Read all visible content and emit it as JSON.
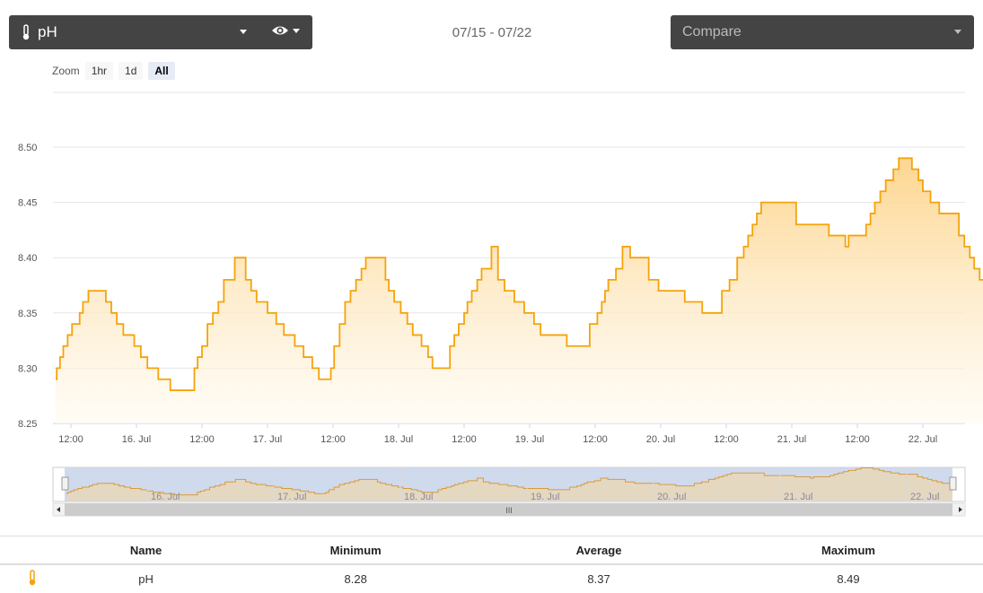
{
  "header": {
    "sensor_label": "pH",
    "sensor_icon": "thermometer-icon",
    "visibility_icon": "eye-icon",
    "date_range": "07/15 - 07/22",
    "compare_placeholder": "Compare"
  },
  "zoom": {
    "label": "Zoom",
    "options": [
      "1hr",
      "1d",
      "All"
    ],
    "selected": "All"
  },
  "colors": {
    "series": "#f5a30b",
    "fill_top": "#fdd48b",
    "fill_bottom": "#fffaf0",
    "navigator_band": "#c7d3ea"
  },
  "chart_data": {
    "type": "area",
    "ylim": [
      8.25,
      8.5
    ],
    "y_ticks": [
      "8.25",
      "8.30",
      "8.35",
      "8.40",
      "8.45",
      "8.50"
    ],
    "x_ticks": [
      "12:00",
      "16. Jul",
      "12:00",
      "17. Jul",
      "12:00",
      "18. Jul",
      "12:00",
      "19. Jul",
      "12:00",
      "20. Jul",
      "12:00",
      "21. Jul",
      "12:00",
      "22. Jul"
    ],
    "x_unit": "hours since the 12:00 tick left of 16. Jul",
    "points": [
      [
        -2.8,
        8.29
      ],
      [
        -2.6,
        8.3
      ],
      [
        -2,
        8.31
      ],
      [
        -1.4,
        8.32
      ],
      [
        -0.6,
        8.33
      ],
      [
        0.2,
        8.34
      ],
      [
        1.6,
        8.35
      ],
      [
        2.2,
        8.36
      ],
      [
        3.2,
        8.37
      ],
      [
        5.8,
        8.37
      ],
      [
        6.4,
        8.36
      ],
      [
        7.4,
        8.35
      ],
      [
        8.4,
        8.34
      ],
      [
        9.6,
        8.33
      ],
      [
        11.6,
        8.32
      ],
      [
        12.8,
        8.31
      ],
      [
        14,
        8.3
      ],
      [
        16,
        8.29
      ],
      [
        18.2,
        8.28
      ],
      [
        22.6,
        8.3
      ],
      [
        23.2,
        8.31
      ],
      [
        24,
        8.32
      ],
      [
        25,
        8.34
      ],
      [
        26,
        8.35
      ],
      [
        27,
        8.36
      ],
      [
        28,
        8.38
      ],
      [
        30,
        8.4
      ],
      [
        32,
        8.38
      ],
      [
        33,
        8.37
      ],
      [
        34,
        8.36
      ],
      [
        36,
        8.35
      ],
      [
        37.6,
        8.34
      ],
      [
        39,
        8.33
      ],
      [
        41,
        8.32
      ],
      [
        42.6,
        8.31
      ],
      [
        44.2,
        8.3
      ],
      [
        45.4,
        8.29
      ],
      [
        47.6,
        8.3
      ],
      [
        48.2,
        8.32
      ],
      [
        49.2,
        8.34
      ],
      [
        50.2,
        8.36
      ],
      [
        51.2,
        8.37
      ],
      [
        52.2,
        8.38
      ],
      [
        53.2,
        8.39
      ],
      [
        54,
        8.4
      ],
      [
        57.6,
        8.38
      ],
      [
        58.2,
        8.37
      ],
      [
        59.2,
        8.36
      ],
      [
        60.4,
        8.35
      ],
      [
        61.6,
        8.34
      ],
      [
        62.6,
        8.33
      ],
      [
        64.2,
        8.32
      ],
      [
        65.4,
        8.31
      ],
      [
        66.2,
        8.3
      ],
      [
        69.4,
        8.32
      ],
      [
        70.2,
        8.33
      ],
      [
        71,
        8.34
      ],
      [
        72,
        8.35
      ],
      [
        72.6,
        8.36
      ],
      [
        73.4,
        8.37
      ],
      [
        74.4,
        8.38
      ],
      [
        75.2,
        8.39
      ],
      [
        77,
        8.41
      ],
      [
        78.2,
        8.38
      ],
      [
        79.4,
        8.37
      ],
      [
        81.2,
        8.36
      ],
      [
        83,
        8.35
      ],
      [
        84.8,
        8.34
      ],
      [
        86,
        8.33
      ],
      [
        90.8,
        8.32
      ],
      [
        95,
        8.34
      ],
      [
        96.4,
        8.35
      ],
      [
        97.2,
        8.36
      ],
      [
        97.8,
        8.37
      ],
      [
        98.4,
        8.38
      ],
      [
        99.8,
        8.39
      ],
      [
        101,
        8.41
      ],
      [
        102.4,
        8.4
      ],
      [
        105.8,
        8.38
      ],
      [
        107.6,
        8.37
      ],
      [
        112.4,
        8.36
      ],
      [
        115.6,
        8.35
      ],
      [
        119.2,
        8.37
      ],
      [
        120.6,
        8.38
      ],
      [
        122,
        8.4
      ],
      [
        123.2,
        8.41
      ],
      [
        124,
        8.42
      ],
      [
        124.8,
        8.43
      ],
      [
        125.6,
        8.44
      ],
      [
        126.4,
        8.45
      ],
      [
        132.8,
        8.43
      ],
      [
        138.8,
        8.42
      ],
      [
        141.8,
        8.41
      ],
      [
        142.4,
        8.42
      ],
      [
        145.6,
        8.43
      ],
      [
        146.4,
        8.44
      ],
      [
        147.2,
        8.45
      ],
      [
        148.2,
        8.46
      ],
      [
        149.2,
        8.47
      ],
      [
        150.6,
        8.48
      ],
      [
        151.6,
        8.49
      ],
      [
        154,
        8.48
      ],
      [
        155.2,
        8.47
      ],
      [
        156,
        8.46
      ],
      [
        157.4,
        8.45
      ],
      [
        159,
        8.44
      ],
      [
        160.2,
        8.44
      ],
      [
        162.6,
        8.42
      ],
      [
        163.6,
        8.41
      ],
      [
        164.6,
        8.4
      ],
      [
        165.4,
        8.39
      ],
      [
        166.4,
        8.38
      ],
      [
        167.4,
        8.37
      ],
      [
        169.4,
        8.37
      ]
    ]
  },
  "navigator": {
    "labels": [
      "16. Jul",
      "17. Jul",
      "18. Jul",
      "19. Jul",
      "20. Jul",
      "21. Jul",
      "22. Jul"
    ],
    "scroll_grip": "III"
  },
  "stats_table": {
    "headers": [
      "Name",
      "Minimum",
      "Average",
      "Maximum"
    ],
    "row": {
      "name": "pH",
      "minimum": "8.28",
      "average": "8.37",
      "maximum": "8.49"
    }
  }
}
